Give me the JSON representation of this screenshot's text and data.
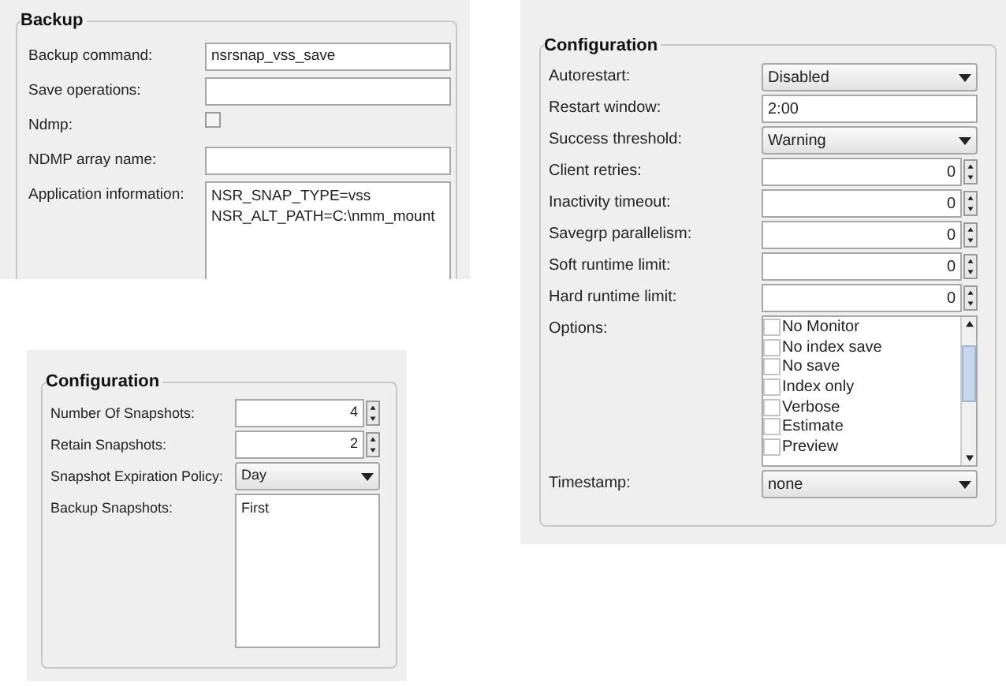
{
  "panels": [
    {
      "title": "Backup",
      "fields": [
        {
          "kind": "text",
          "label": "Backup command:",
          "value": "nsrsnap_vss_save"
        },
        {
          "kind": "text",
          "label": "Save operations:"
        },
        {
          "kind": "checkbox",
          "label": "Ndmp:",
          "checked": false
        },
        {
          "kind": "text",
          "label": "NDMP array name:"
        },
        {
          "kind": "textarea",
          "label": "Application information:",
          "lines": [
            "NSR_SNAP_TYPE=vss",
            "NSR_ALT_PATH=C:\\nmm_mount"
          ]
        }
      ]
    },
    {
      "title": "Configuration",
      "fields": [
        {
          "kind": "select",
          "label": "Autorestart:",
          "value": "Disabled"
        },
        {
          "kind": "text",
          "label": "Restart window:",
          "value": "2:00"
        },
        {
          "kind": "select",
          "label": "Success threshold:",
          "value": "Warning"
        },
        {
          "kind": "spinner",
          "label": "Client retries:",
          "value": "0"
        },
        {
          "kind": "spinner",
          "label": "Inactivity timeout:",
          "value": "0"
        },
        {
          "kind": "spinner",
          "label": "Savegrp parallelism:",
          "value": "0"
        },
        {
          "kind": "spinner",
          "label": "Soft runtime limit:",
          "value": "0"
        },
        {
          "kind": "spinner",
          "label": "Hard runtime limit:",
          "value": "0"
        },
        {
          "kind": "checklist",
          "label": "Options:",
          "options": [
            {
              "label": "No Monitor",
              "checked": false
            },
            {
              "label": "No index save",
              "checked": false
            },
            {
              "label": "No save",
              "checked": false
            },
            {
              "label": "Index only",
              "checked": false
            },
            {
              "label": "Verbose",
              "checked": false
            },
            {
              "label": "Estimate",
              "checked": false
            },
            {
              "label": "Preview",
              "checked": false
            }
          ]
        },
        {
          "kind": "select",
          "label": "Timestamp:",
          "value": "none"
        }
      ]
    },
    {
      "title": "Configuration",
      "fields": [
        {
          "kind": "spinner",
          "label": "Number Of Snapshots:",
          "value": "4"
        },
        {
          "kind": "spinner",
          "label": "Retain Snapshots:",
          "value": "2"
        },
        {
          "kind": "select",
          "label": "Snapshot Expiration Policy:",
          "value": "Day"
        },
        {
          "kind": "textarea",
          "label": "Backup Snapshots:",
          "lines": [
            "First"
          ]
        }
      ]
    }
  ]
}
